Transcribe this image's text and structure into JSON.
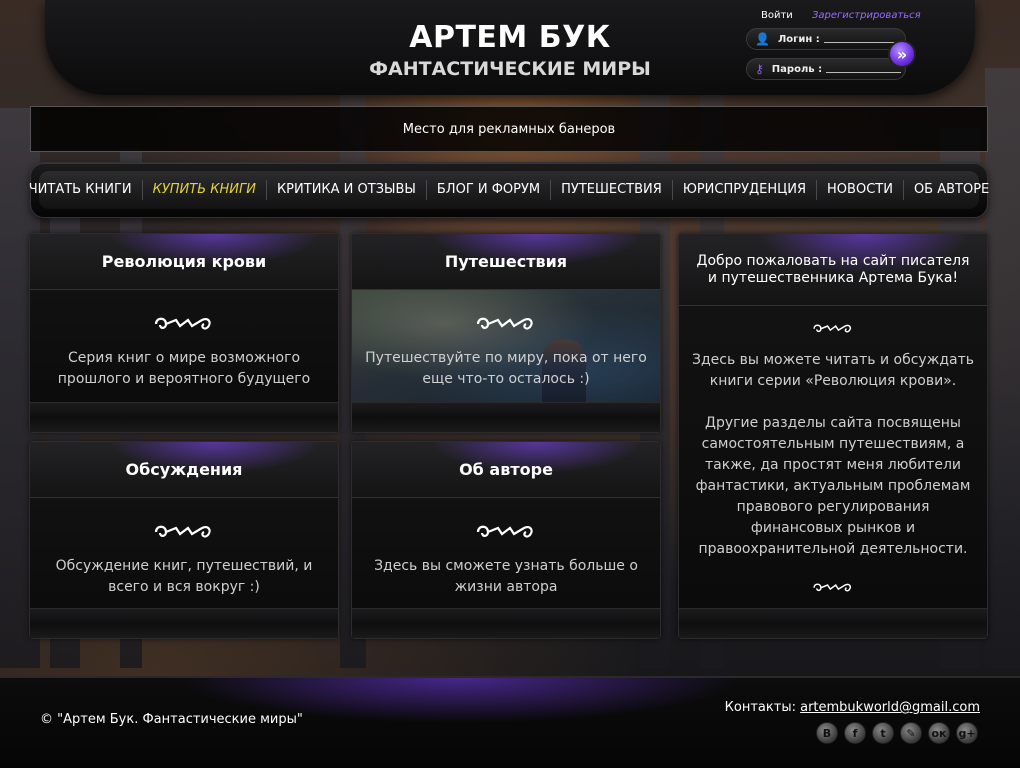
{
  "header": {
    "title": "АРТЕМ БУК",
    "subtitle": "ФАНТАСТИЧЕСКИЕ МИРЫ"
  },
  "login": {
    "enter_label": "Войти",
    "register_label": "Зарегистрироваться",
    "login_label": "Логин :",
    "password_label": "Пароль :"
  },
  "banner": {
    "text": "Место для рекламных банеров"
  },
  "nav": {
    "items": [
      {
        "label": "ЧИТАТЬ КНИГИ"
      },
      {
        "label": "КУПИТЬ КНИГИ",
        "active": true
      },
      {
        "label": "КРИТИКА И ОТЗЫВЫ"
      },
      {
        "label": "БЛОГ И ФОРУМ"
      },
      {
        "label": "ПУТЕШЕСТВИЯ"
      },
      {
        "label": "ЮРИСПРУДЕНЦИЯ"
      },
      {
        "label": "НОВОСТИ"
      },
      {
        "label": "ОБ АВТОРЕ"
      }
    ]
  },
  "panels": {
    "revolution": {
      "title": "Революция крови",
      "text": "Серия книг о мире возможного прошлого и вероятного будущего"
    },
    "travel": {
      "title": "Путешествия",
      "text": "Путешествуйте по миру, пока от него еще что-то осталось :)"
    },
    "discussions": {
      "title": "Обсуждения",
      "text": "Обсуждение книг, путешествий, и всего и вся вокруг :)"
    },
    "about": {
      "title": "Об авторе",
      "text": "Здесь вы сможете узнать больше о жизни автора"
    }
  },
  "welcome": {
    "title": "Добро пожаловать на сайт писателя и путешественника Артема Бука!",
    "paragraph1": "Здесь вы можете читать и обсуждать книги серии «Революция крови».",
    "paragraph2": "Другие разделы сайта посвящены самостоятельным путешествиям, а также, да простят меня любители фантастики, актуальным проблемам правового регулирования финансовых рынков и правоохранительной деятельности."
  },
  "footer": {
    "copyright": "© \"Артем Бук. Фантастические миры\"",
    "contacts_label": "Контакты:",
    "email": "artembukworld@gmail.com",
    "socials": [
      {
        "icon": "vk-icon",
        "glyph": "B"
      },
      {
        "icon": "facebook-icon",
        "glyph": "f"
      },
      {
        "icon": "twitter-icon",
        "glyph": "t"
      },
      {
        "icon": "livejournal-icon",
        "glyph": "✎"
      },
      {
        "icon": "odnoklassniki-icon",
        "glyph": "ок"
      },
      {
        "icon": "googleplus-icon",
        "glyph": "g+"
      }
    ]
  },
  "colors": {
    "accent_purple": "#8a5cf5",
    "active_nav": "#e4d23a"
  }
}
